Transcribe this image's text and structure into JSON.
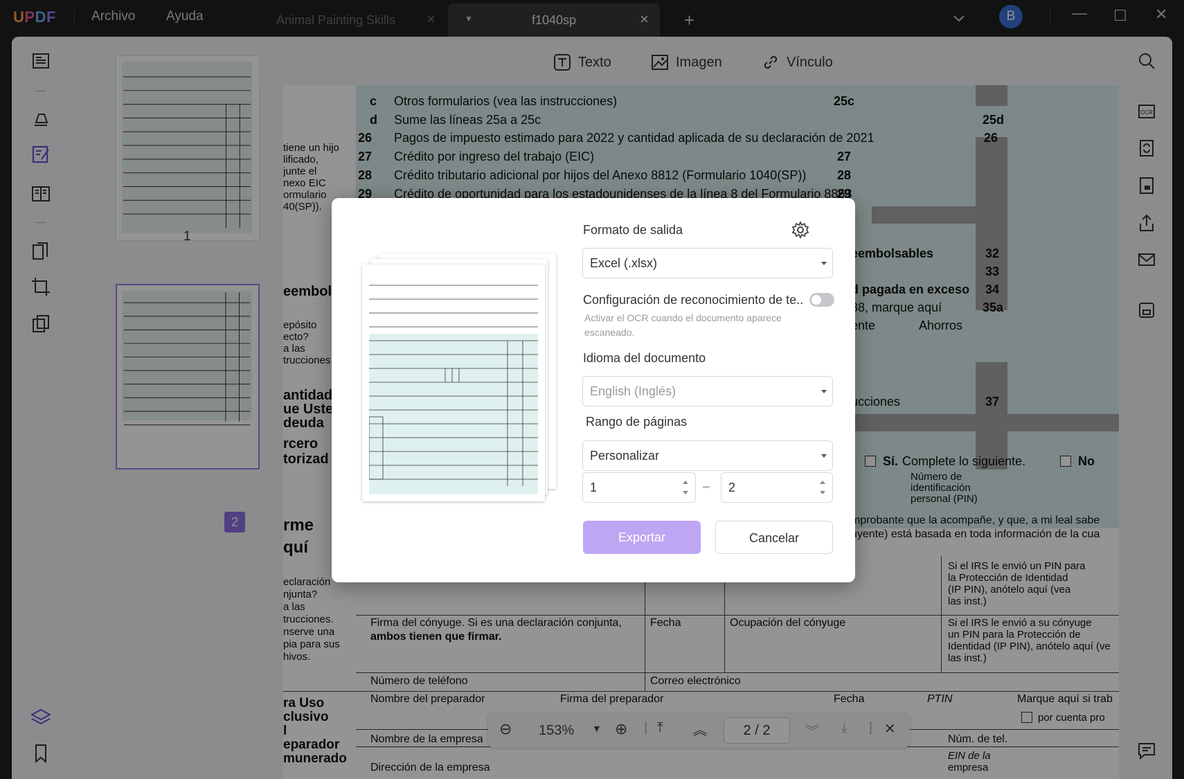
{
  "app": {
    "logo": "UPDF",
    "menu": [
      "Archivo",
      "Ayuda"
    ],
    "tabs": [
      {
        "label": "Animal Painting Skills"
      },
      {
        "label": "f1040sp"
      }
    ],
    "avatar_letter": "B"
  },
  "doc_toolbar": {
    "texto": "Texto",
    "imagen": "Imagen",
    "vinculo": "Vínculo"
  },
  "thumbnails": [
    {
      "label": "1"
    },
    {
      "label": "2"
    }
  ],
  "document": {
    "lines": [
      {
        "num": "c",
        "text": "Otros formularios (vea las instrucciones)",
        "box": "25c"
      },
      {
        "num": "d",
        "text": "Sume las líneas 25a a 25c",
        "box": "25d"
      },
      {
        "num": "26",
        "text": "Pagos de impuesto estimado para 2022 y cantidad aplicada de su declaración de 2021",
        "box": "26"
      },
      {
        "num": "27",
        "text": "Crédito por ingreso del trabajo (EIC)",
        "box": "27"
      },
      {
        "num": "28",
        "text": "Crédito tributario adicional por hijos del Anexo 8812 (Formulario 1040(SP))",
        "box": "28"
      },
      {
        "num": "29",
        "text": "Crédito de oportunidad para los estadounidenses de la línea 8 del Formulario 8863",
        "box": "29"
      }
    ],
    "side_note": [
      "tiene un hijo",
      "lificado,",
      "junte el",
      "nexo EIC",
      "ormulario",
      "40(SP))."
    ],
    "right_items": [
      {
        "text": "eembolsables",
        "box": "32"
      },
      {
        "text": "",
        "box": "33"
      },
      {
        "text": "d pagada en exceso",
        "box": "34"
      },
      {
        "text": "88, marque aquí",
        "box": "35a"
      },
      {
        "text": "ente",
        "extra": "Ahorros"
      },
      {
        "text": "ucciones",
        "box": "37"
      }
    ],
    "left_heads": [
      "eembols",
      "epósito",
      "ecto?",
      "a las",
      "trucciones",
      "antidad",
      "ue Uste",
      "deuda",
      "rcero",
      "torizad",
      "rme",
      "quí",
      "eclaración",
      "njunta?",
      "a las",
      "trucciones.",
      "nserve una",
      "pia para sus",
      "hivos.",
      "ra Uso",
      "clusivo",
      "l",
      "eparador",
      "munerado"
    ],
    "third_party": {
      "si": "Sí.",
      "si_rest": "Complete lo siguiente.",
      "no": "No",
      "pin": [
        "Número de",
        "identificación",
        "personal (PIN)"
      ]
    },
    "decl": [
      "mprobante que la acompañe, y que, a mi leal sabe",
      "uyente) está basada en toda información de la cua"
    ],
    "irs_pin": [
      "Si el IRS le envió un PIN para",
      "la Protección de Identidad",
      "(IP PIN), anótelo aquí (vea",
      "las inst.)"
    ],
    "spouse_sig": [
      "Firma del cónyuge. Si es una declaración conjunta,",
      "ambos tienen que firmar."
    ],
    "fecha": "Fecha",
    "spouse_occ": "Ocupación del cónyuge",
    "irs_pin2": [
      "Si el IRS le envió a su cónyuge",
      "un PIN para la Protección de",
      "Identidad (IP PIN), anótelo aquí (ve",
      "las inst.)"
    ],
    "phone": "Número de teléfono",
    "email": "Correo electrónico",
    "preparer": "Nombre del preparador",
    "preparer_sig": "Firma del preparador",
    "fecha2": "Fecha",
    "ptin": "PTIN",
    "marque": "Marque aquí si trab",
    "cuenta": "por cuenta pro",
    "empresa": "Nombre de la empresa",
    "tel": "Núm. de tel.",
    "ein": [
      "EIN de la",
      "empresa"
    ],
    "dir": "Dirección de la empresa"
  },
  "dialog": {
    "formato_label": "Formato de salida",
    "formato_value": "Excel (.xlsx)",
    "ocr_label": "Configuración de reconocimiento de te...",
    "ocr_hint": "Activar el OCR cuando el documento aparece escaneado.",
    "idioma_label": "Idioma del documento",
    "idioma_value": "English (Inglés)",
    "rango_label": "Rango de páginas",
    "rango_value": "Personalizar",
    "from": "1",
    "to": "2",
    "dash": "–",
    "export_label": "Exportar",
    "cancel_label": "Cancelar"
  },
  "zoom": {
    "value": "153%",
    "page": "2 / 2"
  }
}
